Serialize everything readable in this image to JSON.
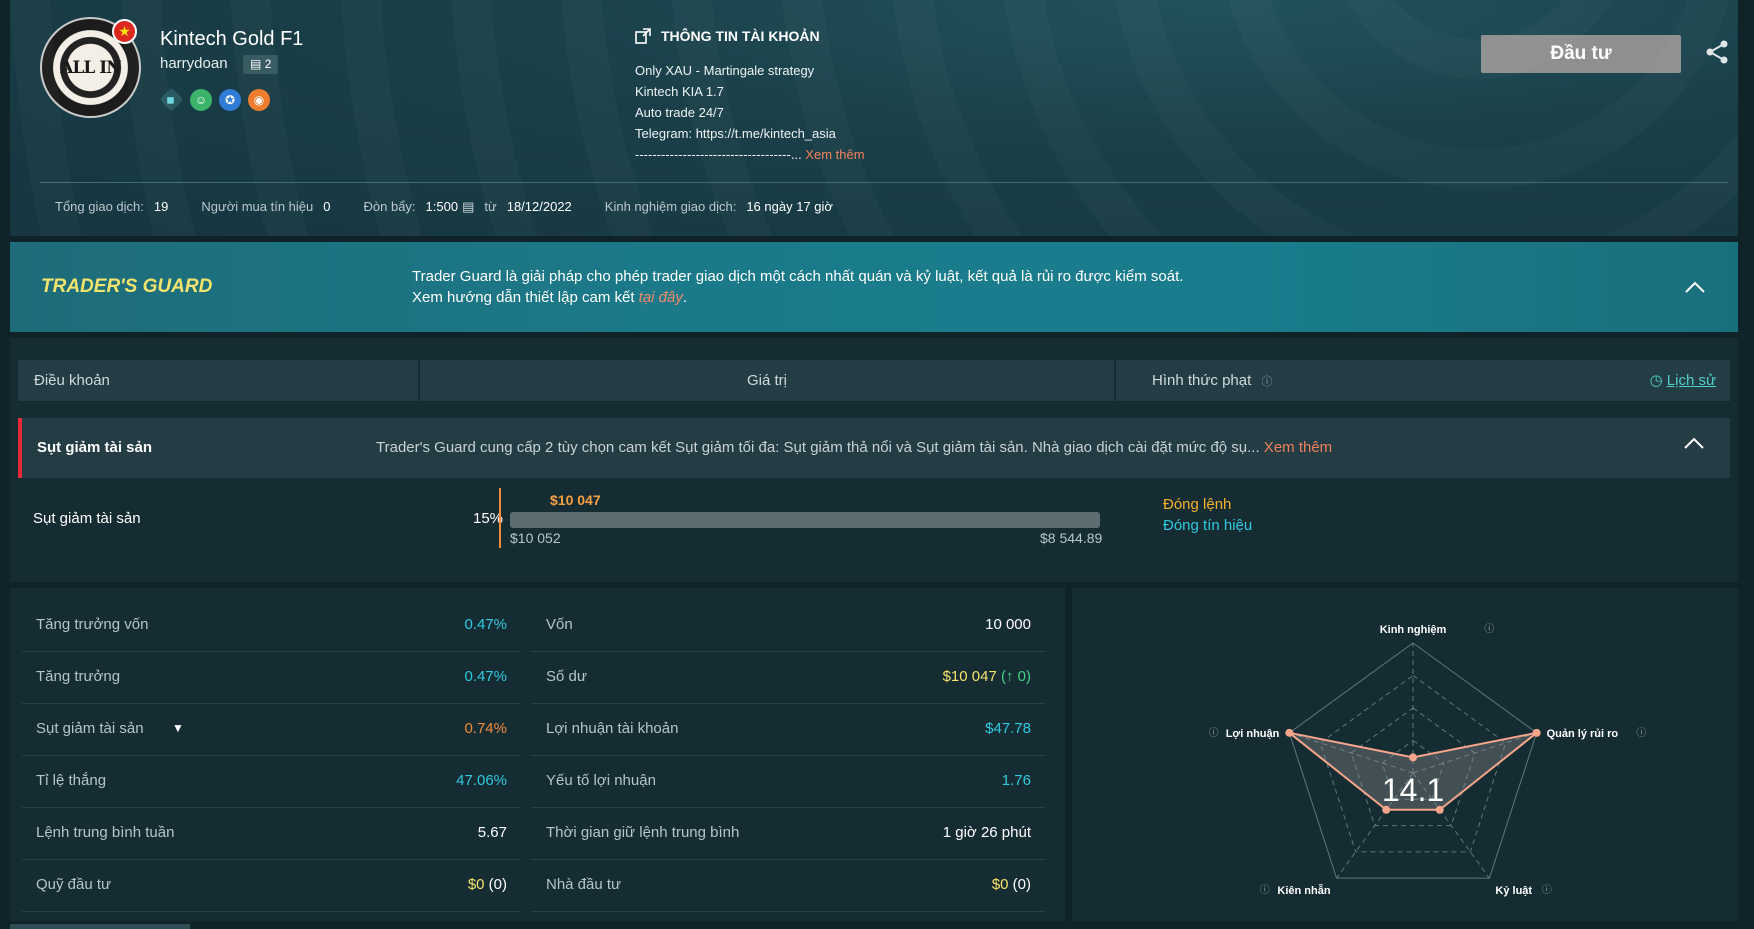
{
  "profile": {
    "avatar_text": "ALL IN",
    "name": "Kintech Gold F1",
    "handle": "harrydoan",
    "follower_count": "2",
    "flag_icon": "vietnam-flag-icon",
    "badge_icons": [
      "diamond-icon",
      "robot-icon",
      "medal-icon",
      "signal-icon"
    ]
  },
  "account": {
    "title": "THÔNG TIN TÀI KHOẢN",
    "lines": [
      "Only XAU - Martingale strategy",
      "Kintech KIA 1.7",
      "Auto trade 24/7",
      "Telegram: https://t.me/kintech_asia"
    ],
    "dashes": "------------------------------------...",
    "more": " Xem thêm"
  },
  "actions": {
    "invest": "Đầu tư",
    "share_icon": "share-icon"
  },
  "stats": {
    "total_trades_label": "Tổng giao dịch:",
    "total_trades": "19",
    "buyers_label": "Người mua tín hiệu",
    "buyers": "0",
    "leverage_label": "Đòn bẩy:",
    "leverage": "1:500",
    "since_label": "từ",
    "since": "18/12/2022",
    "experience_label": "Kinh nghiệm giao dịch:",
    "experience": "16 ngày 17 giờ"
  },
  "guard": {
    "title": "TRADER'S GUARD",
    "line1": "Trader Guard là giải pháp cho phép trader giao dịch một cách nhất quán và kỷ luật, kết quả là rủi ro được kiểm soát.",
    "line2": "Xem hướng dẫn thiết lập cam kết ",
    "link": "tại đây",
    "period": "."
  },
  "terms": {
    "col_term": "Điều khoản",
    "col_value": "Giá trị",
    "col_penalty": "Hình thức phạt",
    "history": "Lịch sử",
    "drawdown_title": "Sụt giảm tài sản",
    "drawdown_desc": "Trader's Guard cung cấp 2 tùy chọn cam kết Sụt giảm tối đa: Sụt giảm thả nổi và Sụt giảm tài sản. Nhà giao dịch cài đặt mức độ sụ...",
    "drawdown_more": " Xem thêm",
    "row_label": "Sụt giảm tài sản",
    "row_pct": "15%",
    "current_value": "$10 047",
    "start_value": "$10 052",
    "limit_value": "$8 544.89",
    "penalty1": "Đóng lệnh",
    "penalty2": "Đóng tín hiệu"
  },
  "metrics_left": [
    {
      "label": "Tăng trưởng vốn",
      "value": "0.47%",
      "color": "#2fc9e0"
    },
    {
      "label": "Tăng trưởng",
      "value": "0.47%",
      "color": "#2fc9e0"
    },
    {
      "label": "Sụt giảm tài sản",
      "value": "0.74%",
      "color": "#f08c3a"
    },
    {
      "label": "Tỉ lệ thắng",
      "value": "47.06%",
      "color": "#2fc9e0"
    },
    {
      "label": "Lệnh trung bình tuần",
      "value": "5.67",
      "color": "#ffffff"
    },
    {
      "label": "Quỹ đầu tư",
      "value": "$0",
      "extra": " (0)",
      "color": "#f5e46c"
    }
  ],
  "metrics_right": [
    {
      "label": "Vốn",
      "value": "10 000",
      "color": "#ffffff"
    },
    {
      "label": "Số dư",
      "value": "$10 047",
      "extra": " (↑ 0)",
      "color": "#f5e46c"
    },
    {
      "label": "Lợi nhuận tài khoản",
      "value": "$47.78",
      "color": "#2fc9e0"
    },
    {
      "label": "Yếu tố lợi nhuận",
      "value": "1.76",
      "color": "#2fc9e0"
    },
    {
      "label": "Thời gian giữ lệnh trung bình",
      "value": "1 giờ 26 phút",
      "color": "#ffffff"
    },
    {
      "label": "Nhà đầu tư",
      "value": "$0",
      "extra": " (0)",
      "color": "#f5e46c"
    }
  ],
  "radar": {
    "score": "14.1",
    "axes": [
      "Kinh nghiệm",
      "Quản lý rủi ro",
      "Kỷ luật",
      "Kiên nhẫn",
      "Lợi nhuận"
    ],
    "values": [
      0.12,
      1.0,
      0.35,
      0.35,
      1.0
    ],
    "max": 1.0,
    "color": "#f4a58a"
  }
}
